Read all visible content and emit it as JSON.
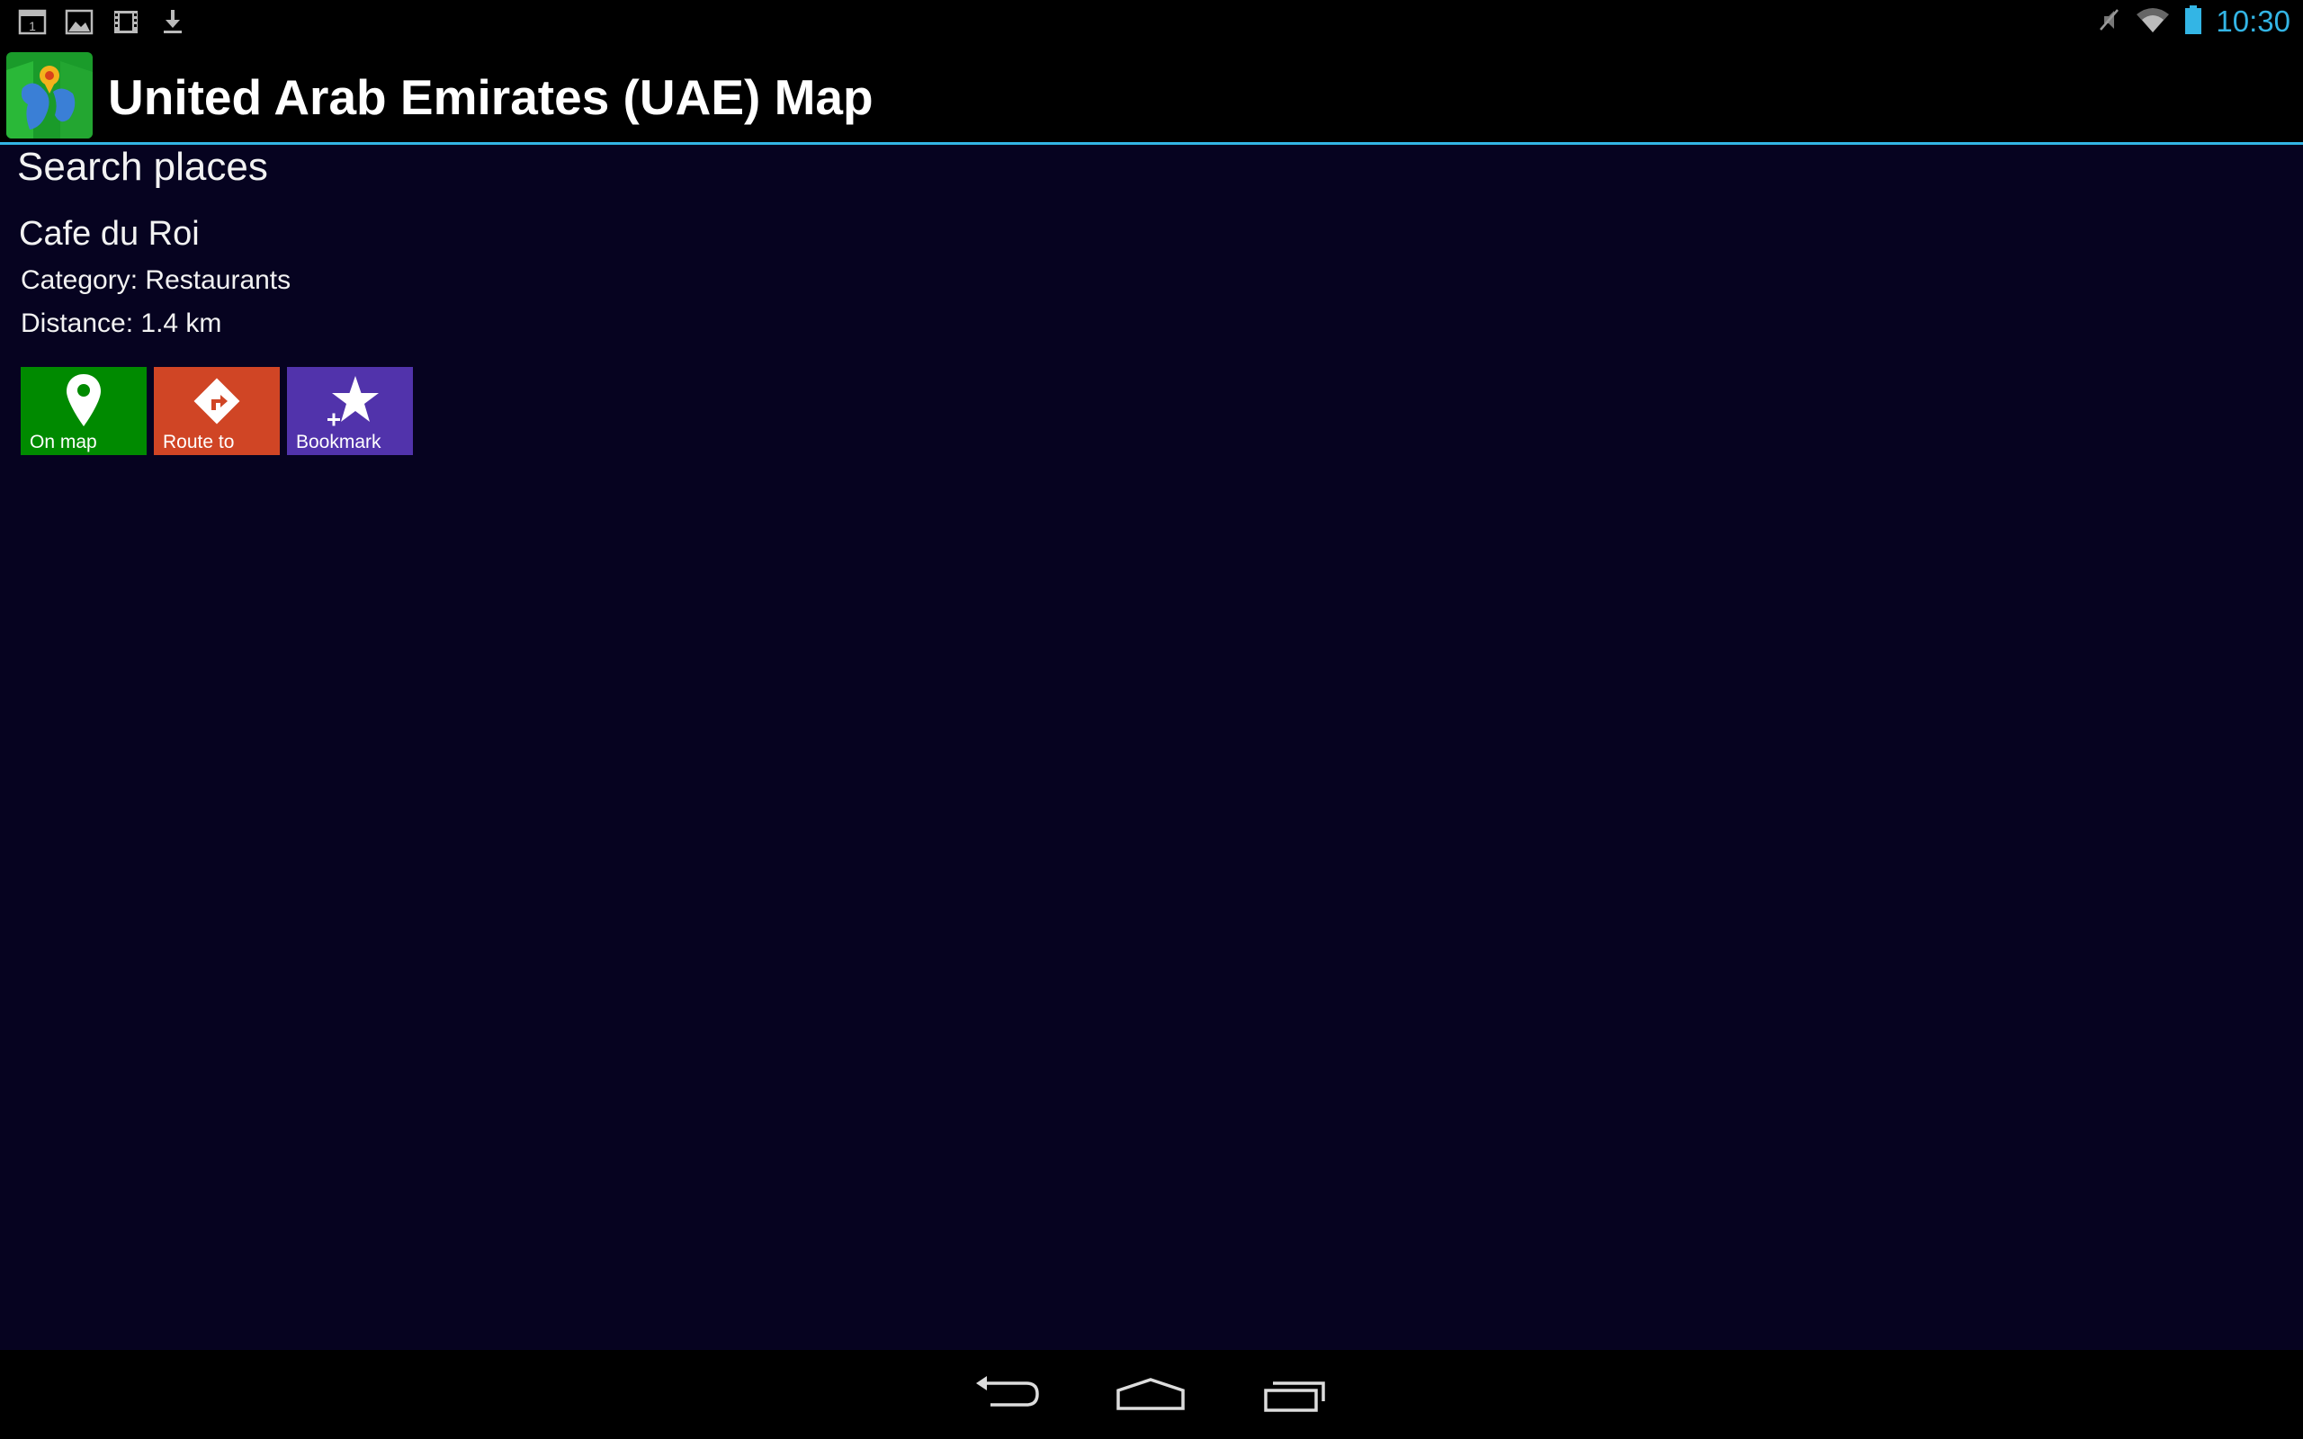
{
  "status_bar": {
    "notification_icons": [
      "calendar-icon",
      "image-icon",
      "film-icon",
      "download-icon"
    ],
    "system_icons": [
      "mute-icon",
      "wifi-icon",
      "battery-icon"
    ],
    "time": "10:30",
    "calendar_day": "1",
    "accent_color": "#33b5e5"
  },
  "action_bar": {
    "app_icon": "map-app-icon",
    "title": "United Arab Emirates (UAE) Map"
  },
  "screen": {
    "section_title": "Search places",
    "background_color": "#060320"
  },
  "place": {
    "name": "Cafe du Roi",
    "category_line": "Category: Restaurants",
    "distance_line": "Distance: 1.4 km"
  },
  "actions": [
    {
      "label": "On map",
      "icon": "map-pin-icon",
      "color": "#008a00"
    },
    {
      "label": "Route to",
      "icon": "route-sign-icon",
      "color": "#d04525"
    },
    {
      "label": "Bookmark",
      "icon": "star-add-icon",
      "color": "#5133ab"
    }
  ],
  "nav_bar": {
    "buttons": [
      "back-icon",
      "home-icon",
      "recent-apps-icon"
    ]
  }
}
